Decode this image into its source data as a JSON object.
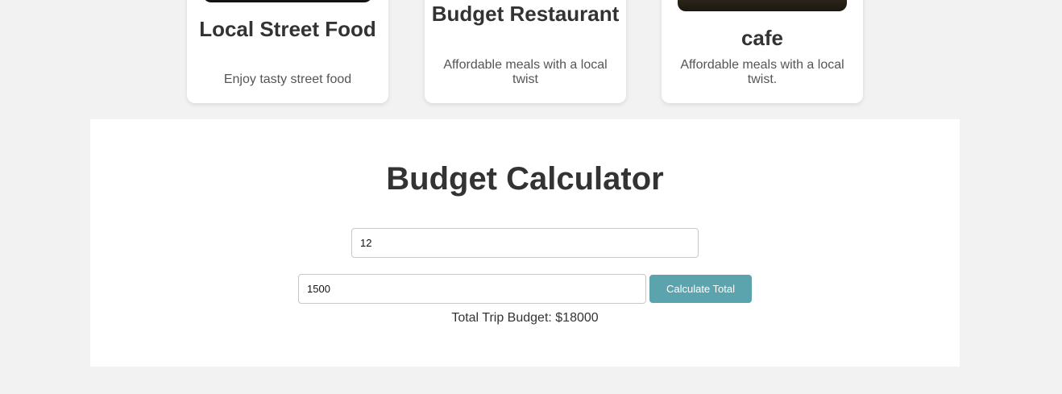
{
  "cards": [
    {
      "title": "Local Street Food",
      "description": "Enjoy tasty street food"
    },
    {
      "title": "Budget Restaurant",
      "description": "Affordable meals with a local twist"
    },
    {
      "title": "cafe",
      "description": "Affordable meals with a local twist."
    }
  ],
  "calculator": {
    "title": "Budget Calculator",
    "days_value": "12",
    "daily_cost_value": "1500",
    "button_label": "Calculate Total",
    "result_text": "Total Trip Budget: $18000"
  },
  "colors": {
    "page_background": "#f2f2f2",
    "button_accent": "#5ba4ae",
    "card_background": "#ffffff"
  }
}
